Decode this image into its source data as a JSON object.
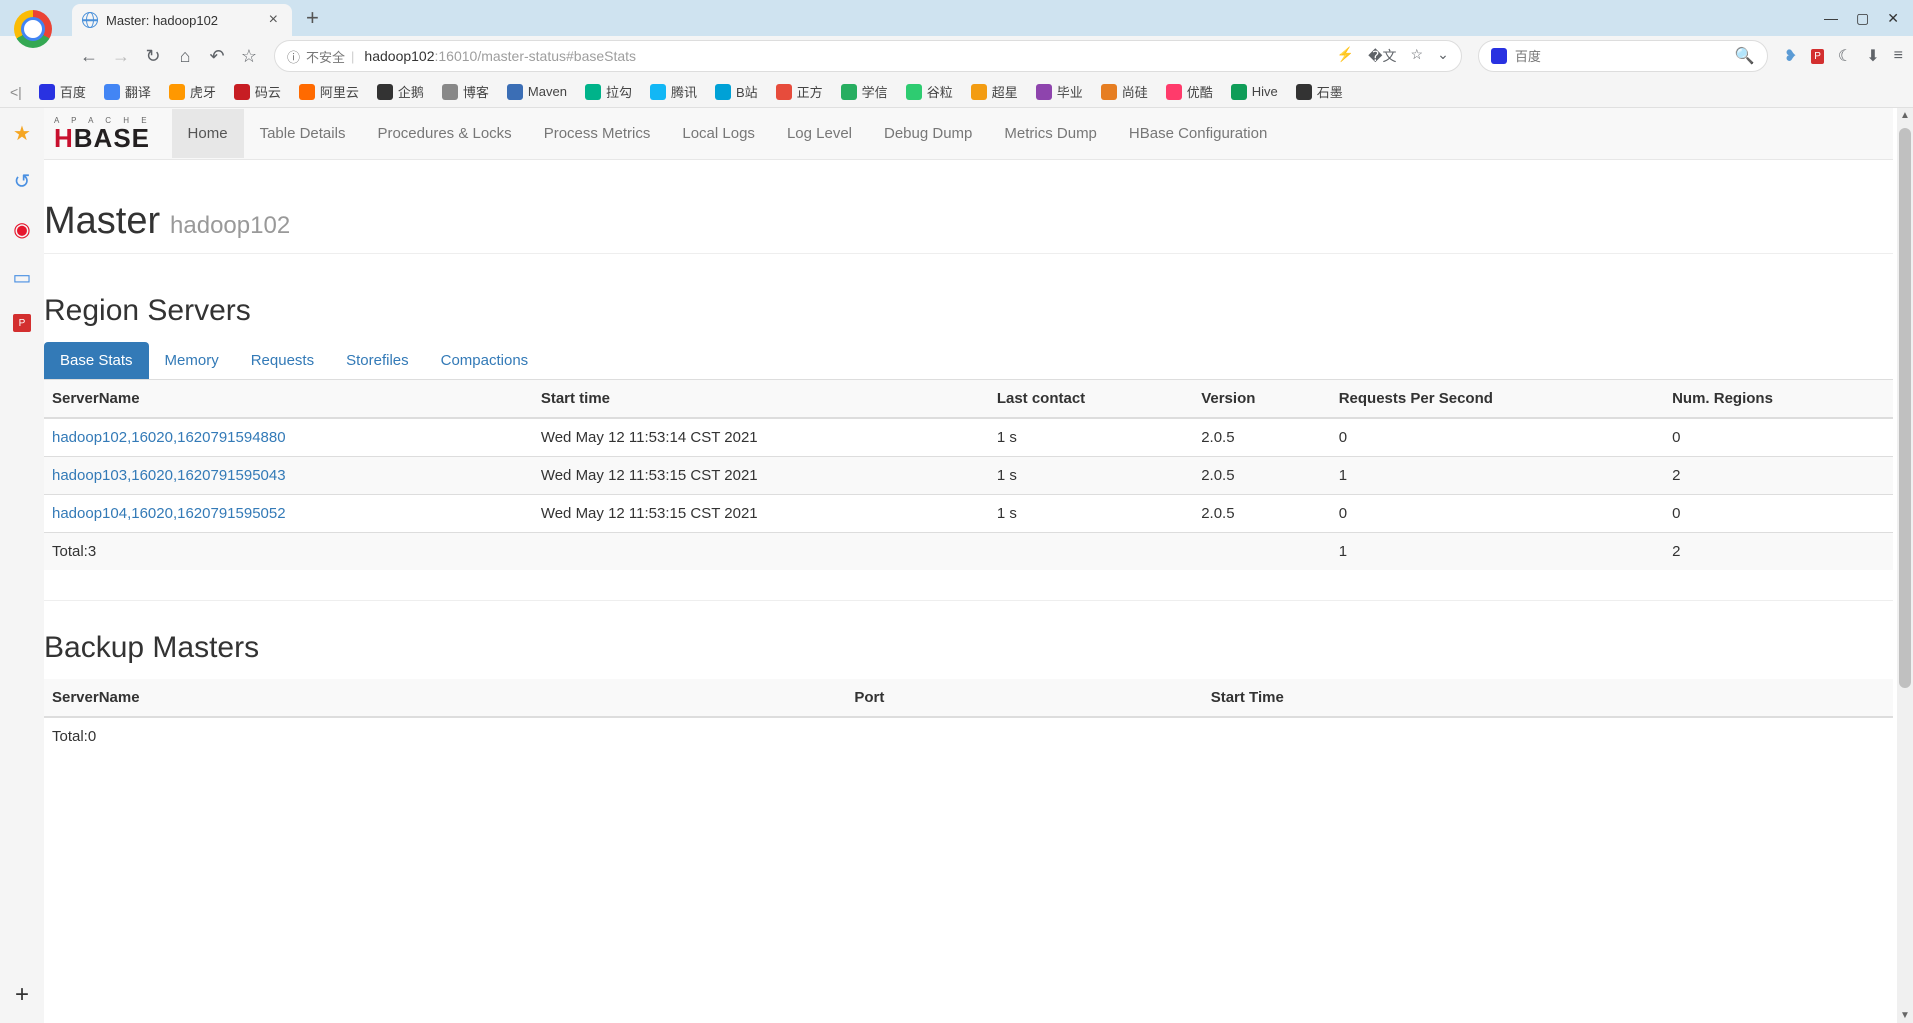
{
  "browser": {
    "tab_title": "Master: hadoop102",
    "url_security": "不安全",
    "url_host": "hadoop102",
    "url_port_path": ":16010/master-status#baseStats",
    "search_placeholder": "百度"
  },
  "bookmarks": [
    {
      "label": "百度",
      "color": "#2932e1"
    },
    {
      "label": "翻译",
      "color": "#4285f4"
    },
    {
      "label": "虎牙",
      "color": "#ff9800"
    },
    {
      "label": "码云",
      "color": "#c71d23"
    },
    {
      "label": "阿里云",
      "color": "#ff6a00"
    },
    {
      "label": "企鹅",
      "color": "#333"
    },
    {
      "label": "博客",
      "color": "#888"
    },
    {
      "label": "Maven",
      "color": "#3b6eb5"
    },
    {
      "label": "拉勾",
      "color": "#00b38a"
    },
    {
      "label": "腾讯",
      "color": "#12b7f5"
    },
    {
      "label": "B站",
      "color": "#00a1d6"
    },
    {
      "label": "正方",
      "color": "#e74c3c"
    },
    {
      "label": "学信",
      "color": "#27ae60"
    },
    {
      "label": "谷粒",
      "color": "#2ecc71"
    },
    {
      "label": "超星",
      "color": "#f39c12"
    },
    {
      "label": "毕业",
      "color": "#8e44ad"
    },
    {
      "label": "尚硅",
      "color": "#e67e22"
    },
    {
      "label": "优酷",
      "color": "#ff3b6b"
    },
    {
      "label": "Hive",
      "color": "#0f9d58"
    },
    {
      "label": "石墨",
      "color": "#333"
    }
  ],
  "hbase_nav": [
    "Home",
    "Table Details",
    "Procedures & Locks",
    "Process Metrics",
    "Local Logs",
    "Log Level",
    "Debug Dump",
    "Metrics Dump",
    "HBase Configuration"
  ],
  "page_title": "Master",
  "page_subtitle": "hadoop102",
  "region_servers": {
    "heading": "Region Servers",
    "tabs": [
      "Base Stats",
      "Memory",
      "Requests",
      "Storefiles",
      "Compactions"
    ],
    "columns": [
      "ServerName",
      "Start time",
      "Last contact",
      "Version",
      "Requests Per Second",
      "Num. Regions"
    ],
    "rows": [
      {
        "server": "hadoop102,16020,1620791594880",
        "start": "Wed May 12 11:53:14 CST 2021",
        "contact": "1 s",
        "version": "2.0.5",
        "rps": "0",
        "regions": "0"
      },
      {
        "server": "hadoop103,16020,1620791595043",
        "start": "Wed May 12 11:53:15 CST 2021",
        "contact": "1 s",
        "version": "2.0.5",
        "rps": "1",
        "regions": "2"
      },
      {
        "server": "hadoop104,16020,1620791595052",
        "start": "Wed May 12 11:53:15 CST 2021",
        "contact": "1 s",
        "version": "2.0.5",
        "rps": "0",
        "regions": "0"
      }
    ],
    "total_label": "Total:3",
    "total_rps": "1",
    "total_regions": "2"
  },
  "backup_masters": {
    "heading": "Backup Masters",
    "columns": [
      "ServerName",
      "Port",
      "Start Time"
    ],
    "total_label": "Total:0"
  }
}
